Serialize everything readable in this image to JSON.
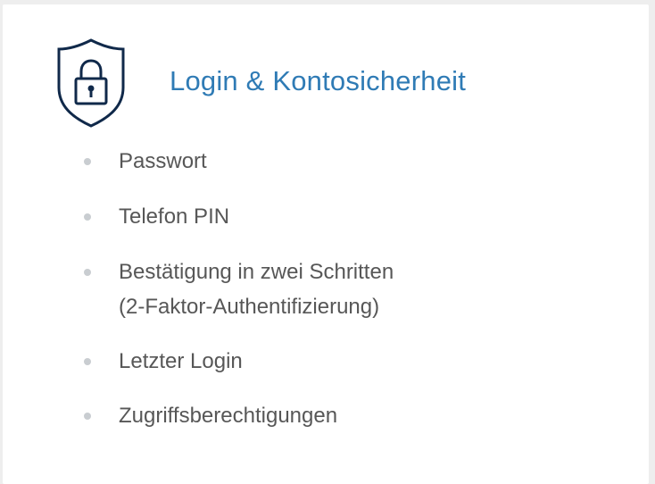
{
  "card": {
    "title": "Login & Kontosicherheit",
    "icon": "shield-lock-icon",
    "items": [
      {
        "label": "Passwort"
      },
      {
        "label": "Telefon PIN"
      },
      {
        "label": "Bestätigung in zwei Schritten",
        "sub": "(2-Faktor-Authentifizierung)"
      },
      {
        "label": "Letzter Login"
      },
      {
        "label": "Zugriffsberechtigungen"
      }
    ]
  },
  "colors": {
    "title": "#2f7bb5",
    "icon_stroke": "#10294a",
    "text": "#575757",
    "bullet": "#c9cdd1"
  }
}
